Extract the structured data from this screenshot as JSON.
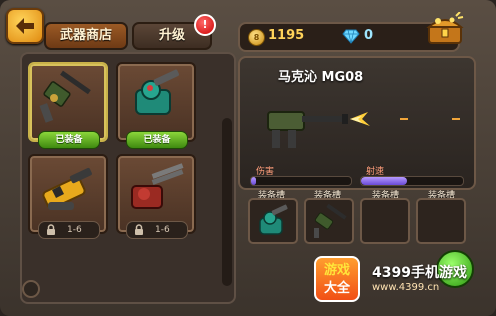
{
  "header": {
    "back_button": "back-arrow-icon",
    "tab_shop": "武器商店",
    "tab_upgrade": "升级",
    "upgrade_badge": "!"
  },
  "currency": {
    "coin_icon": "coin-icon",
    "coin_symbol": "8",
    "coins": "1195",
    "gem_icon": "diamond-icon",
    "gems": "0",
    "chest_icon": "treasure-chest-icon"
  },
  "weapons": [
    {
      "name_icon": "machine-gun-icon",
      "status": "已装备",
      "selected": true
    },
    {
      "name_icon": "green-turret-icon",
      "status": "已装备",
      "selected": false
    },
    {
      "name_icon": "yellow-cannon-icon",
      "status": "locked",
      "level": "1-6"
    },
    {
      "name_icon": "red-gatling-icon",
      "status": "locked",
      "level": "1-6"
    }
  ],
  "detail": {
    "weapon_name": "马克沁 MG08",
    "damage_label": "伤害",
    "damage_value": 0.05,
    "rate_label": "射速",
    "rate_value": 0.45
  },
  "slots": {
    "label": "装备槽",
    "items": [
      "green-turret-icon",
      "machine-gun-icon",
      "",
      ""
    ]
  },
  "watermark": {
    "logo_line1": "游戏",
    "logo_line2": "大全",
    "site": "4399手机游戏",
    "url": "www.4399.cn"
  },
  "colors": {
    "accent": "#e08a10",
    "equipped": "#5bb11f",
    "bar": "#8b6ef0"
  }
}
